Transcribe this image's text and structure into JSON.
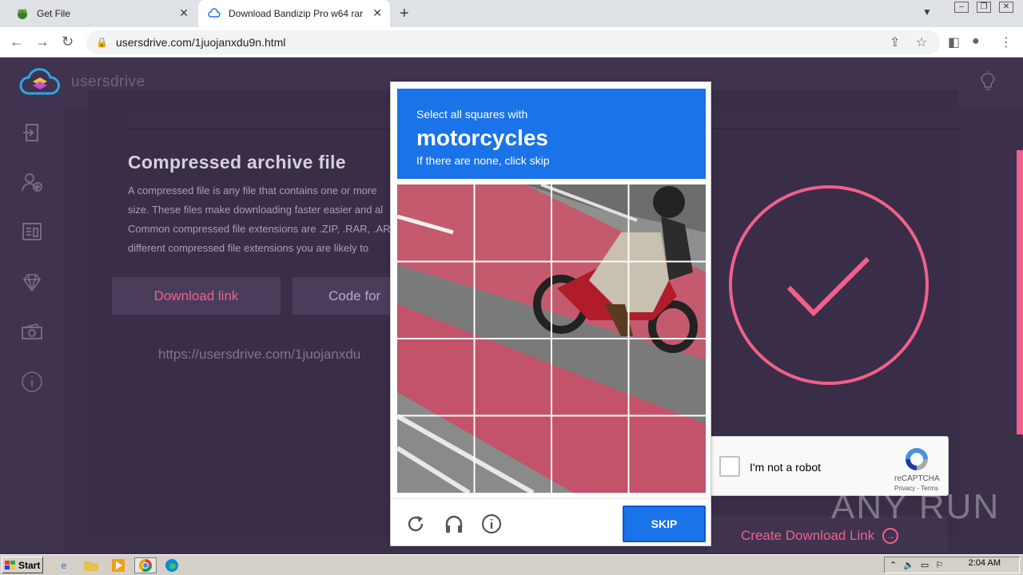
{
  "browser": {
    "tabs": [
      {
        "title": "Get File"
      },
      {
        "title": "Download Bandizip Pro w64 rar"
      }
    ],
    "url": "usersdrive.com/1juojanxdu9n.html"
  },
  "site": {
    "brand": "usersdrive",
    "heading": "Compressed archive file",
    "desc_lines": [
      "A compressed file is any file that contains one or more",
      "size. These files make downloading faster easier and al",
      "Common compressed file extensions are .ZIP, .RAR, .AR",
      "different compressed file extensions you are likely to"
    ],
    "tab_download": "Download link",
    "tab_code": "Code for",
    "download_url": "https://usersdrive.com/1juojanxdu",
    "create_button": "Create Download Link"
  },
  "recaptcha": {
    "label": "I'm not a robot",
    "brand": "reCAPTCHA",
    "links": "Privacy - Terms",
    "challenge": {
      "line1": "Select all squares with",
      "keyword": "motorcycles",
      "line3": "If there are none, click skip",
      "skip": "SKIP"
    }
  },
  "watermark": "ANY RUN",
  "taskbar": {
    "start": "Start",
    "clock": "2:04 AM"
  },
  "colors": {
    "accent": "#f0608a",
    "recaptcha_blue": "#1a73e8",
    "page_bg": "#3b2f4a"
  }
}
